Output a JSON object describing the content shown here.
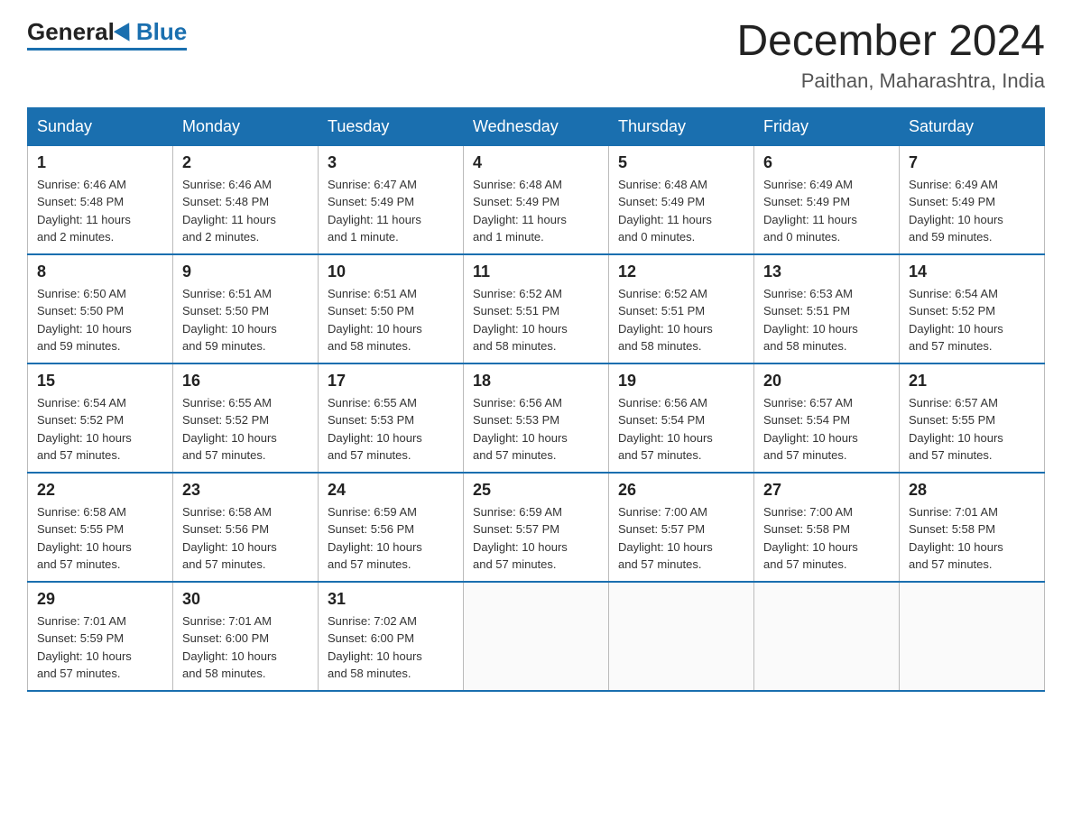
{
  "header": {
    "logo": {
      "general": "General",
      "blue": "Blue"
    },
    "title": "December 2024",
    "location": "Paithan, Maharashtra, India"
  },
  "calendar": {
    "days_of_week": [
      "Sunday",
      "Monday",
      "Tuesday",
      "Wednesday",
      "Thursday",
      "Friday",
      "Saturday"
    ],
    "weeks": [
      [
        {
          "day": "1",
          "info": "Sunrise: 6:46 AM\nSunset: 5:48 PM\nDaylight: 11 hours\nand 2 minutes."
        },
        {
          "day": "2",
          "info": "Sunrise: 6:46 AM\nSunset: 5:48 PM\nDaylight: 11 hours\nand 2 minutes."
        },
        {
          "day": "3",
          "info": "Sunrise: 6:47 AM\nSunset: 5:49 PM\nDaylight: 11 hours\nand 1 minute."
        },
        {
          "day": "4",
          "info": "Sunrise: 6:48 AM\nSunset: 5:49 PM\nDaylight: 11 hours\nand 1 minute."
        },
        {
          "day": "5",
          "info": "Sunrise: 6:48 AM\nSunset: 5:49 PM\nDaylight: 11 hours\nand 0 minutes."
        },
        {
          "day": "6",
          "info": "Sunrise: 6:49 AM\nSunset: 5:49 PM\nDaylight: 11 hours\nand 0 minutes."
        },
        {
          "day": "7",
          "info": "Sunrise: 6:49 AM\nSunset: 5:49 PM\nDaylight: 10 hours\nand 59 minutes."
        }
      ],
      [
        {
          "day": "8",
          "info": "Sunrise: 6:50 AM\nSunset: 5:50 PM\nDaylight: 10 hours\nand 59 minutes."
        },
        {
          "day": "9",
          "info": "Sunrise: 6:51 AM\nSunset: 5:50 PM\nDaylight: 10 hours\nand 59 minutes."
        },
        {
          "day": "10",
          "info": "Sunrise: 6:51 AM\nSunset: 5:50 PM\nDaylight: 10 hours\nand 58 minutes."
        },
        {
          "day": "11",
          "info": "Sunrise: 6:52 AM\nSunset: 5:51 PM\nDaylight: 10 hours\nand 58 minutes."
        },
        {
          "day": "12",
          "info": "Sunrise: 6:52 AM\nSunset: 5:51 PM\nDaylight: 10 hours\nand 58 minutes."
        },
        {
          "day": "13",
          "info": "Sunrise: 6:53 AM\nSunset: 5:51 PM\nDaylight: 10 hours\nand 58 minutes."
        },
        {
          "day": "14",
          "info": "Sunrise: 6:54 AM\nSunset: 5:52 PM\nDaylight: 10 hours\nand 57 minutes."
        }
      ],
      [
        {
          "day": "15",
          "info": "Sunrise: 6:54 AM\nSunset: 5:52 PM\nDaylight: 10 hours\nand 57 minutes."
        },
        {
          "day": "16",
          "info": "Sunrise: 6:55 AM\nSunset: 5:52 PM\nDaylight: 10 hours\nand 57 minutes."
        },
        {
          "day": "17",
          "info": "Sunrise: 6:55 AM\nSunset: 5:53 PM\nDaylight: 10 hours\nand 57 minutes."
        },
        {
          "day": "18",
          "info": "Sunrise: 6:56 AM\nSunset: 5:53 PM\nDaylight: 10 hours\nand 57 minutes."
        },
        {
          "day": "19",
          "info": "Sunrise: 6:56 AM\nSunset: 5:54 PM\nDaylight: 10 hours\nand 57 minutes."
        },
        {
          "day": "20",
          "info": "Sunrise: 6:57 AM\nSunset: 5:54 PM\nDaylight: 10 hours\nand 57 minutes."
        },
        {
          "day": "21",
          "info": "Sunrise: 6:57 AM\nSunset: 5:55 PM\nDaylight: 10 hours\nand 57 minutes."
        }
      ],
      [
        {
          "day": "22",
          "info": "Sunrise: 6:58 AM\nSunset: 5:55 PM\nDaylight: 10 hours\nand 57 minutes."
        },
        {
          "day": "23",
          "info": "Sunrise: 6:58 AM\nSunset: 5:56 PM\nDaylight: 10 hours\nand 57 minutes."
        },
        {
          "day": "24",
          "info": "Sunrise: 6:59 AM\nSunset: 5:56 PM\nDaylight: 10 hours\nand 57 minutes."
        },
        {
          "day": "25",
          "info": "Sunrise: 6:59 AM\nSunset: 5:57 PM\nDaylight: 10 hours\nand 57 minutes."
        },
        {
          "day": "26",
          "info": "Sunrise: 7:00 AM\nSunset: 5:57 PM\nDaylight: 10 hours\nand 57 minutes."
        },
        {
          "day": "27",
          "info": "Sunrise: 7:00 AM\nSunset: 5:58 PM\nDaylight: 10 hours\nand 57 minutes."
        },
        {
          "day": "28",
          "info": "Sunrise: 7:01 AM\nSunset: 5:58 PM\nDaylight: 10 hours\nand 57 minutes."
        }
      ],
      [
        {
          "day": "29",
          "info": "Sunrise: 7:01 AM\nSunset: 5:59 PM\nDaylight: 10 hours\nand 57 minutes."
        },
        {
          "day": "30",
          "info": "Sunrise: 7:01 AM\nSunset: 6:00 PM\nDaylight: 10 hours\nand 58 minutes."
        },
        {
          "day": "31",
          "info": "Sunrise: 7:02 AM\nSunset: 6:00 PM\nDaylight: 10 hours\nand 58 minutes."
        },
        {
          "day": "",
          "info": ""
        },
        {
          "day": "",
          "info": ""
        },
        {
          "day": "",
          "info": ""
        },
        {
          "day": "",
          "info": ""
        }
      ]
    ]
  }
}
